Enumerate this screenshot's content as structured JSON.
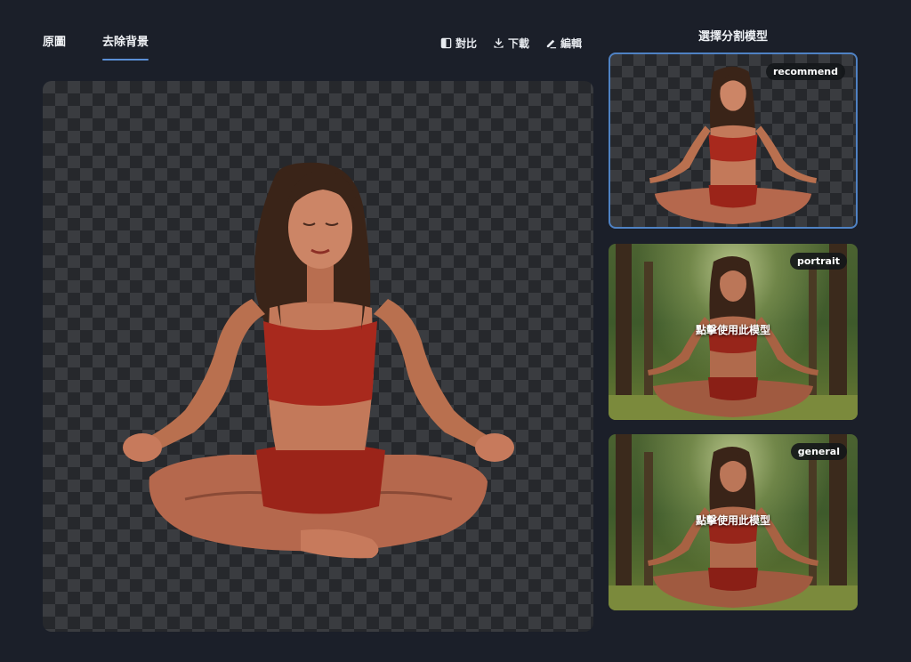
{
  "tabs": {
    "original": "原圖",
    "removed": "去除背景"
  },
  "toolbar": {
    "compare": "對比",
    "download": "下載",
    "edit": "編輯"
  },
  "panel": {
    "title": "選擇分割模型",
    "models": [
      {
        "badge": "recommend",
        "hint": ""
      },
      {
        "badge": "portrait",
        "hint": "點擊使用此模型"
      },
      {
        "badge": "general",
        "hint": "點擊使用此模型"
      }
    ]
  },
  "colors": {
    "background": "#1b1f29",
    "accent": "#5b8fd6",
    "selected_border": "#4f82c4"
  }
}
